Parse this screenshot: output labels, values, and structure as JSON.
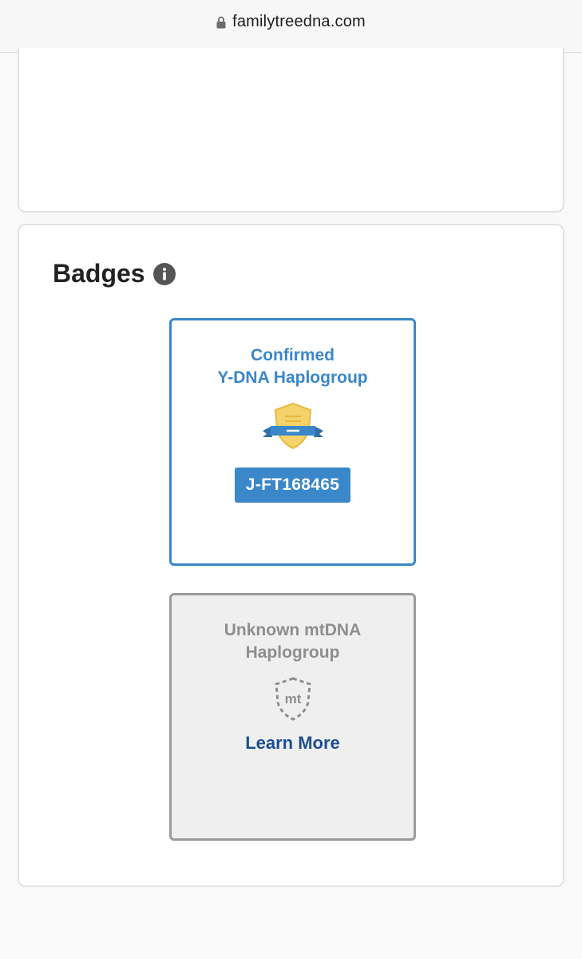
{
  "browser": {
    "url": "familytreedna.com",
    "lock_icon": "lock-icon"
  },
  "badges_section": {
    "title": "Badges",
    "info_icon": "info-icon",
    "confirmed_badge": {
      "title": "Confirmed\nY-DNA Haplogroup",
      "icon": "ribbon-shield-icon",
      "haplogroup": "J-FT168465",
      "accent_color": "#3a87c9"
    },
    "unknown_badge": {
      "title": "Unknown mtDNA\nHaplogroup",
      "icon": "mt-shield-icon",
      "icon_text": "mt",
      "link_label": "Learn More",
      "link_color": "#1d4f8f"
    }
  }
}
